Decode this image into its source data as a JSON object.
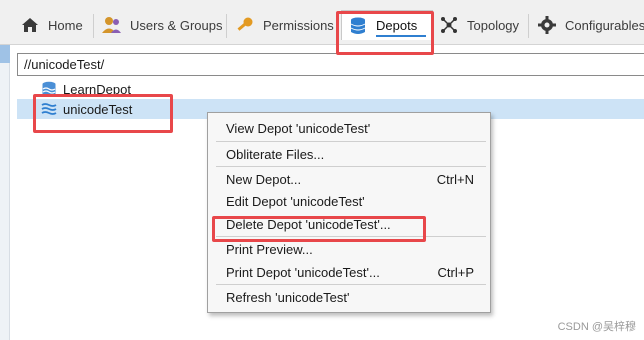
{
  "tabs": [
    {
      "label": "Home",
      "icon": "home-icon"
    },
    {
      "label": "Users & Groups",
      "icon": "users-icon"
    },
    {
      "label": "Permissions",
      "icon": "key-icon"
    },
    {
      "label": "Depots",
      "icon": "database-icon"
    },
    {
      "label": "Topology",
      "icon": "topology-icon"
    },
    {
      "label": "Configurables",
      "icon": "gear-icon"
    }
  ],
  "path_value": "//unicodeTest/",
  "tree": [
    {
      "label": "LearnDepot",
      "icon": "depot-icon"
    },
    {
      "label": "unicodeTest",
      "icon": "depot-icon",
      "selected": true
    }
  ],
  "menu": {
    "view_depot": "View Depot 'unicodeTest'",
    "obliterate": "Obliterate Files...",
    "new_depot": "New Depot...",
    "new_depot_shortcut": "Ctrl+N",
    "edit_depot": "Edit Depot 'unicodeTest'",
    "delete_depot": "Delete Depot 'unicodeTest'...",
    "print_preview": "Print Preview...",
    "print_depot": "Print Depot 'unicodeTest'...",
    "print_depot_shortcut": "Ctrl+P",
    "refresh": "Refresh 'unicodeTest'"
  },
  "watermark": "CSDN @吴梓穆",
  "colors": {
    "annotation": "#e8474a",
    "selection": "#cde3f6",
    "tab_accent": "#2f7fd0"
  }
}
